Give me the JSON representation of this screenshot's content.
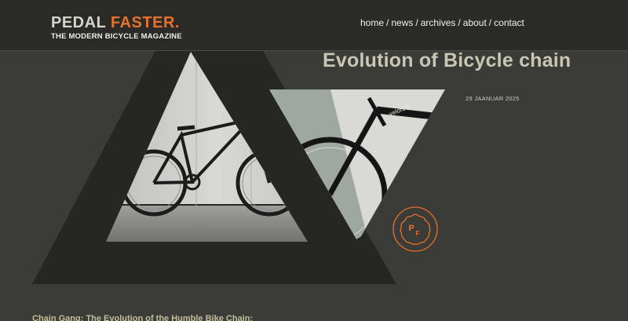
{
  "site": {
    "brand_part1": "PEDAL",
    "brand_part2": "FASTER.",
    "tagline": "THE MODERN BICYCLE MAGAZINE"
  },
  "nav": {
    "items": [
      "home",
      "news",
      "archives",
      "about",
      "contact"
    ],
    "separator": "/"
  },
  "article": {
    "title": "Evolution of Bicycle chain",
    "date": "29 JAANUAR 2025",
    "subtitle": "Chain Gang: The Evolution of the Humble Bike Chain:"
  },
  "badge": {
    "initials_top": "P",
    "initials_bottom": "F"
  },
  "colors": {
    "background": "#3b3b37",
    "topbar": "#2a2a27",
    "accent_orange": "#e8712e",
    "triangle_dark": "#262622",
    "title_text": "#c9c6b6"
  },
  "icons": {
    "badge": "pf-logo-badge-icon",
    "hero": "bicycle-photo"
  }
}
